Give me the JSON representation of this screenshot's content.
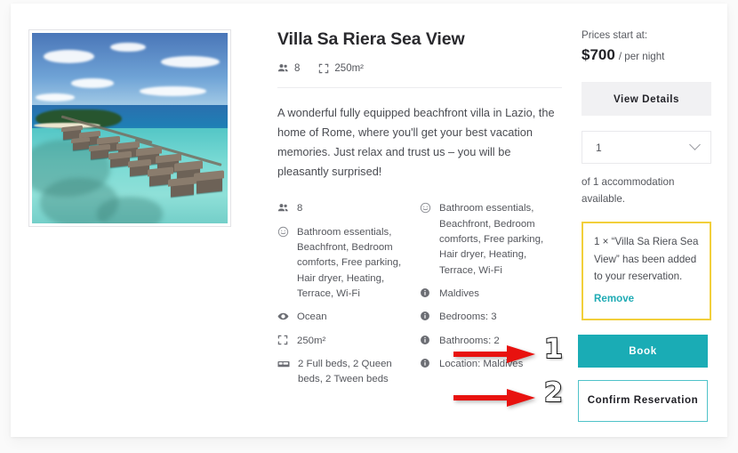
{
  "listing": {
    "title": "Villa Sa Riera Sea View",
    "photo_alt": "aerial-view-of-overwater-villas-maldives",
    "meta": [
      {
        "icon": "guests-icon",
        "value": "8"
      },
      {
        "icon": "area-icon",
        "value": "250m²"
      }
    ],
    "description": "A wonderful fully equipped beachfront villa in Lazio, the home of Rome, where you'll get your best vacation memories. Just relax and trust us – you will be pleasantly surprised!",
    "amenities_left": [
      {
        "icon": "guests-icon",
        "text": "8"
      },
      {
        "icon": "smiley-icon",
        "text": "Bathroom essentials, Beachfront, Bedroom comforts, Free parking, Hair dryer, Heating, Terrace, Wi-Fi"
      },
      {
        "icon": "eye-icon",
        "text": "Ocean"
      },
      {
        "icon": "area-icon",
        "text": "250m²"
      },
      {
        "icon": "bed-icon",
        "text": "2 Full beds, 2 Queen beds, 2 Tween beds"
      }
    ],
    "amenities_right": [
      {
        "icon": "smiley-icon",
        "text": "Bathroom essentials, Beachfront, Bedroom comforts, Free parking, Hair dryer, Heating, Terrace, Wi-Fi"
      },
      {
        "icon": "info-icon",
        "text": "Maldives"
      },
      {
        "icon": "info-icon",
        "text": "Bedrooms: 3"
      },
      {
        "icon": "info-icon",
        "text": "Bathrooms: 2"
      },
      {
        "icon": "info-icon",
        "text": "Location: Maldives"
      }
    ]
  },
  "sidebar": {
    "price_label": "Prices start at:",
    "price_amount": "$700",
    "price_period": "/ per night",
    "view_details_label": "View Details",
    "quantity_value": "1",
    "quantity_icon": "chevron-down-icon",
    "availability": "of 1 accommodation available.",
    "notice_text": "1 × “Villa Sa Riera Sea View” has been added to your reservation.",
    "notice_remove_label": "Remove",
    "book_label": "Book",
    "confirm_label": "Confirm Reservation"
  },
  "annotations": {
    "step_one": "1",
    "step_two": "2",
    "arrow_icon": "arrow-right-icon"
  },
  "colors": {
    "accent_teal": "#1aacb5",
    "confirm_border": "#4fc3c9",
    "notice_border": "#f2cf3b",
    "annotation_red": "#e8120f",
    "details_bg": "#f1f1f3"
  }
}
